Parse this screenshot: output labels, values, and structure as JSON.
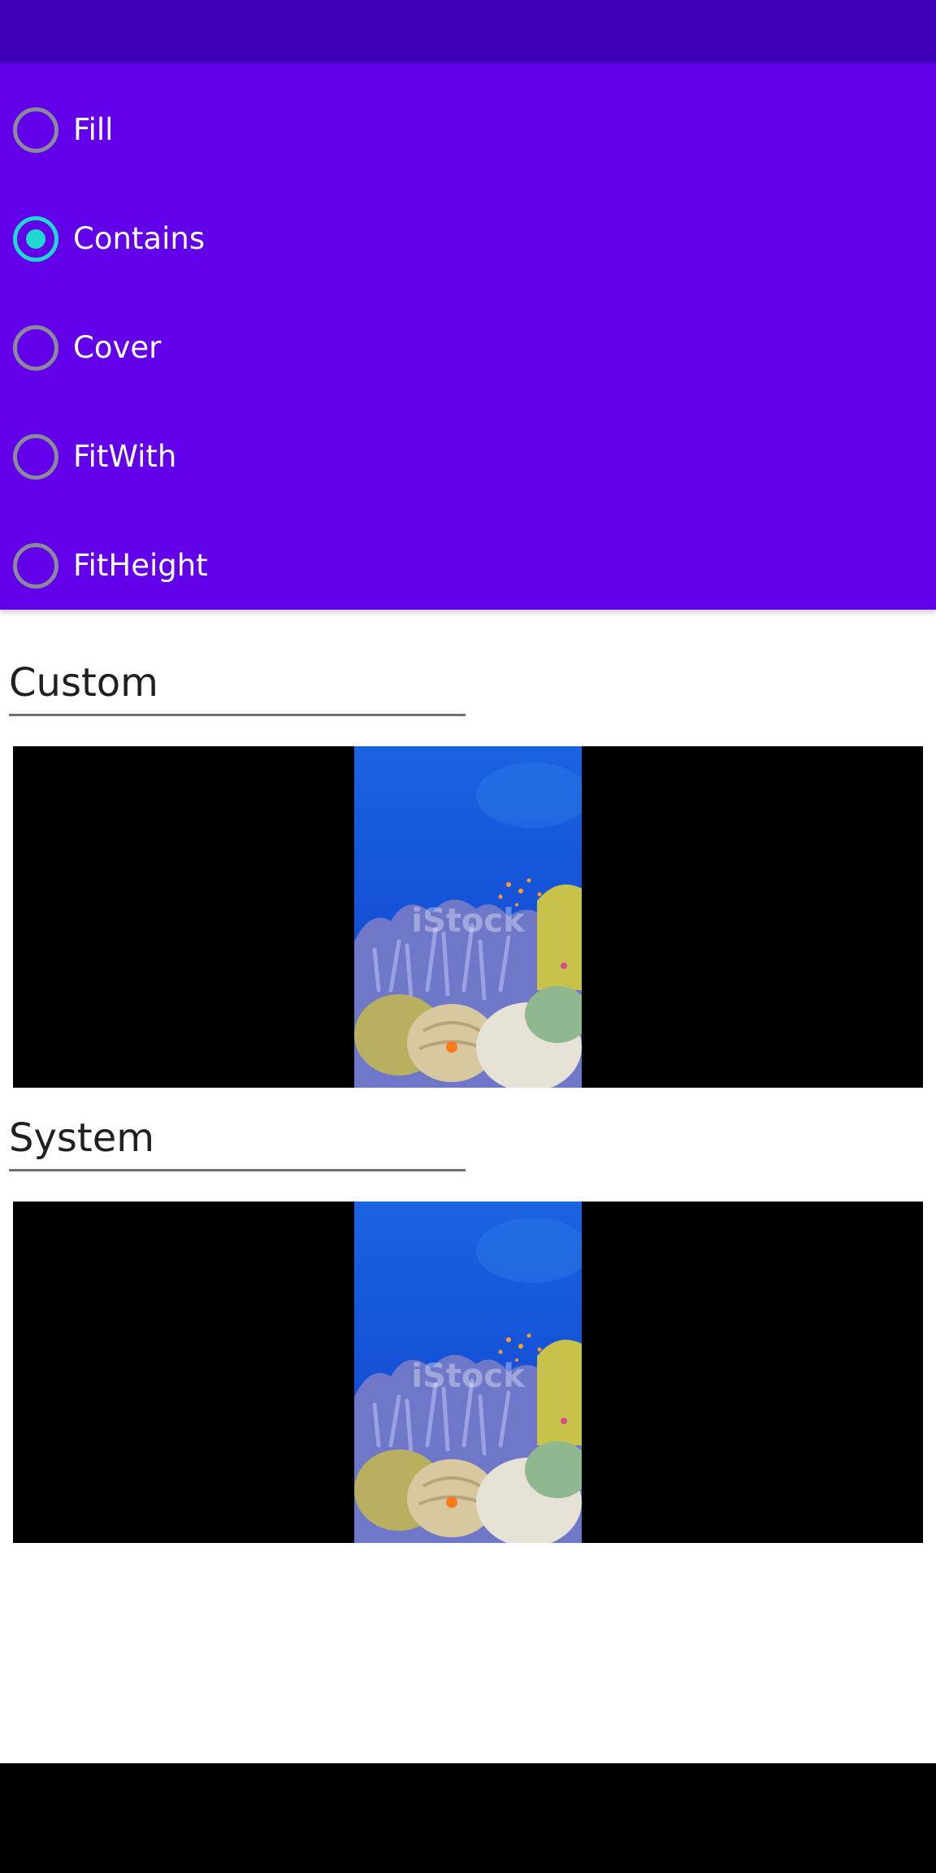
{
  "scale_modes": {
    "options": [
      {
        "label": "Fill",
        "checked": false
      },
      {
        "label": "Contains",
        "checked": true
      },
      {
        "label": "Cover",
        "checked": false
      },
      {
        "label": "FitWith",
        "checked": false
      },
      {
        "label": "FitHeight",
        "checked": false
      }
    ]
  },
  "sections": {
    "custom_title": "Custom",
    "system_title": "System"
  },
  "video": {
    "watermark_text": "iStock"
  },
  "colors": {
    "status_bar": "#3f00b8",
    "panel": "#6200ea",
    "radio_checked": "#1fd8cf",
    "radio_unchecked": "#8a8a9a"
  }
}
